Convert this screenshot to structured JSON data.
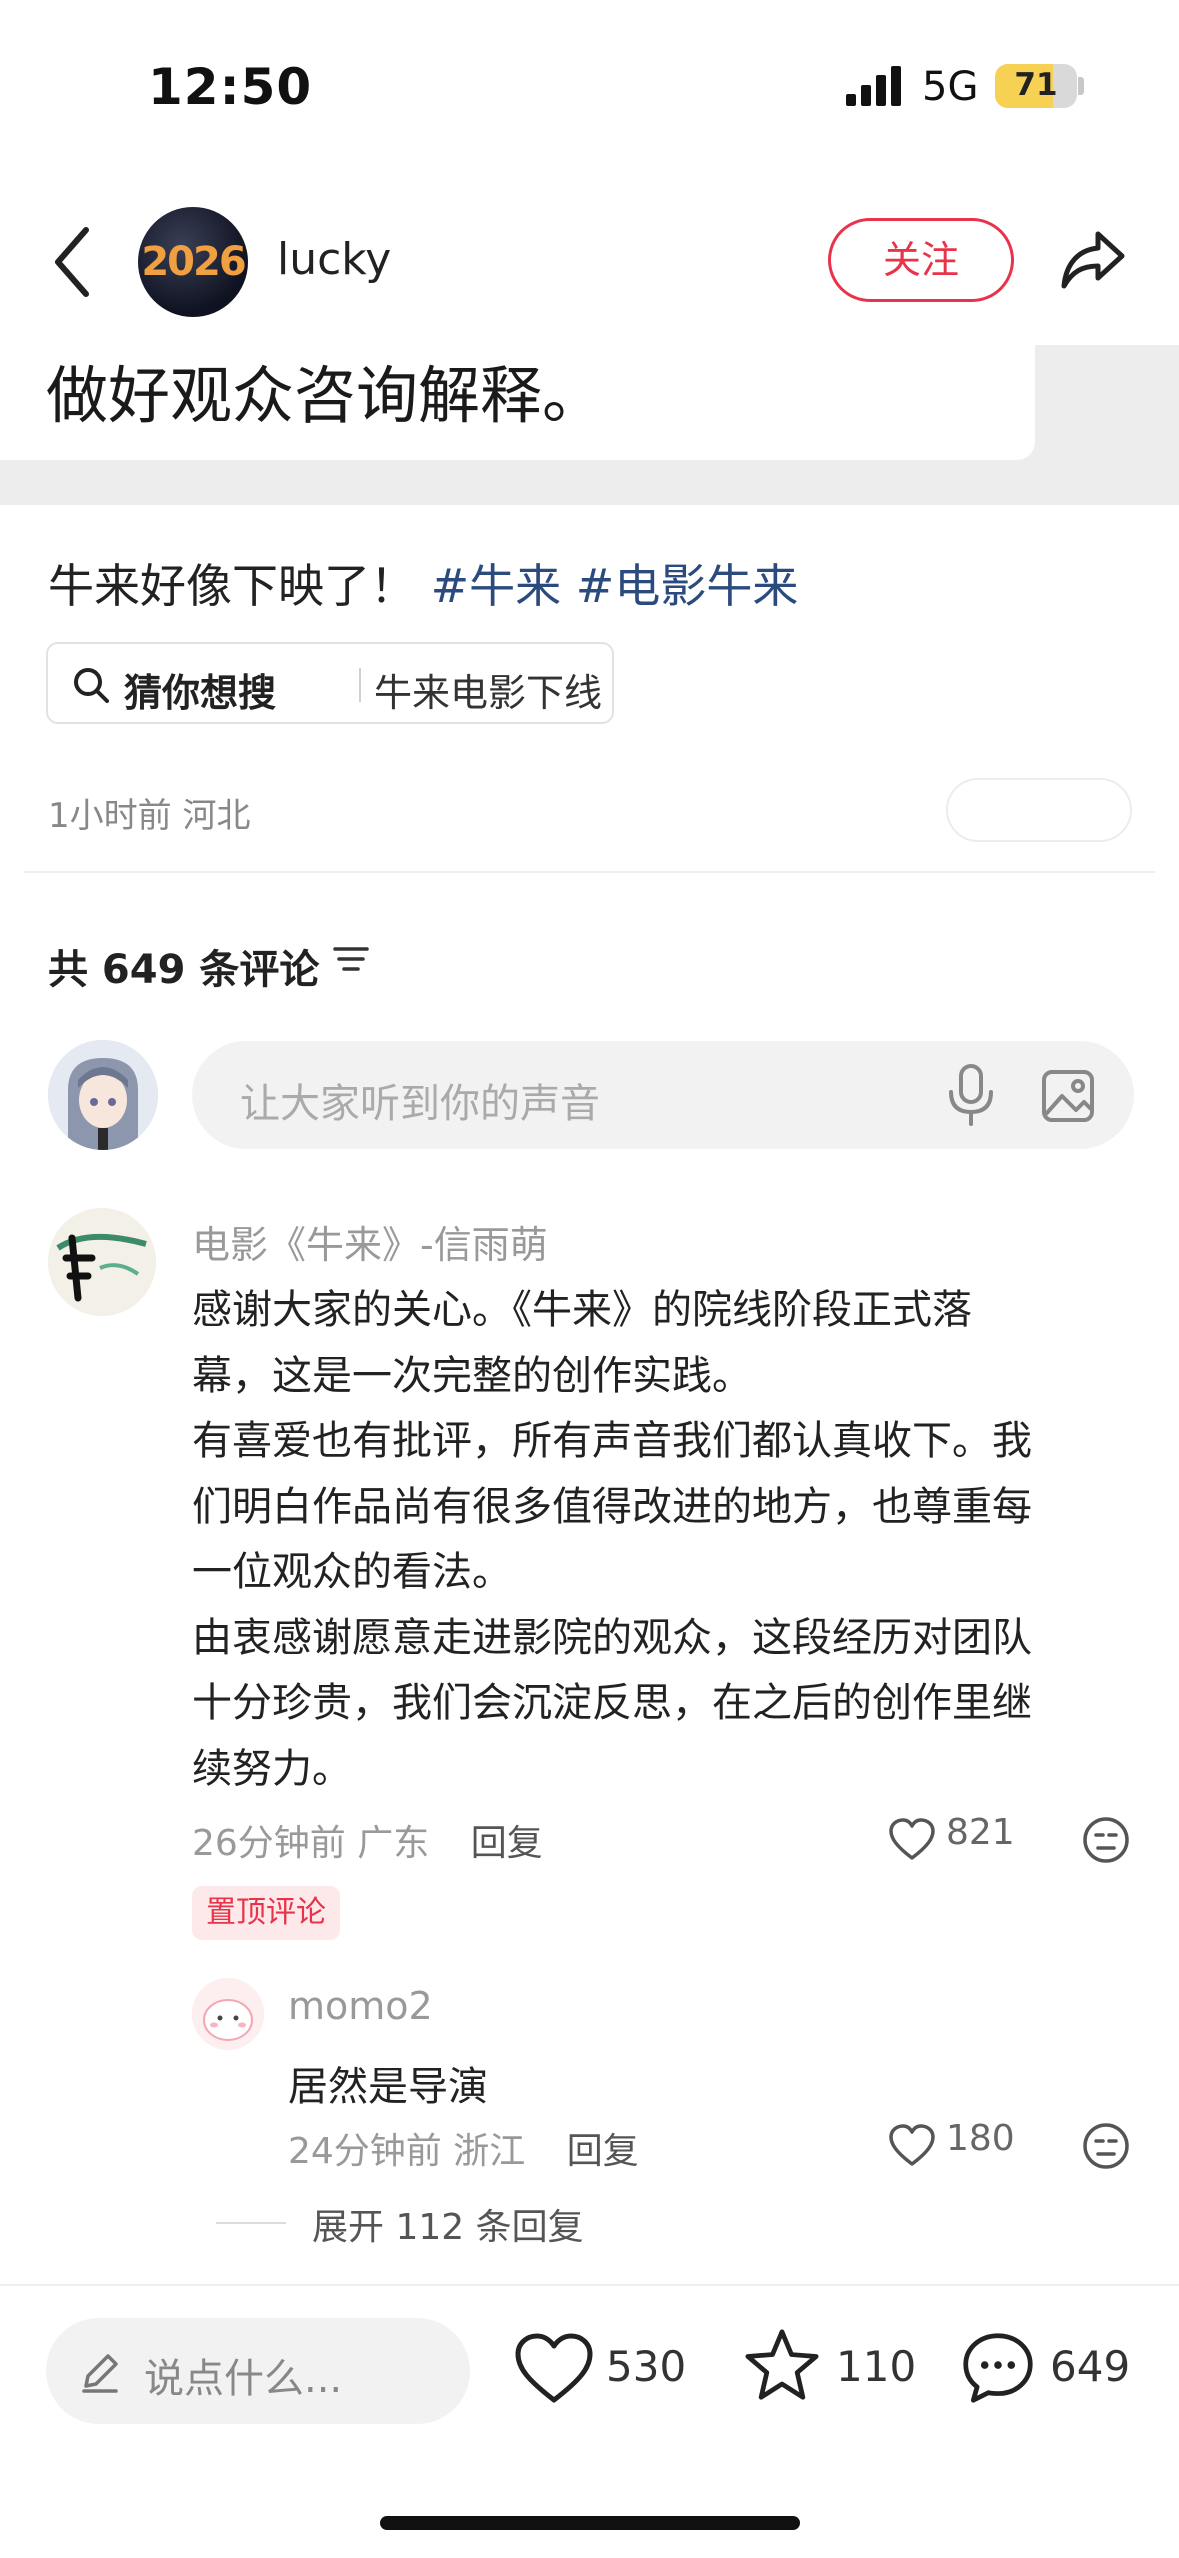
{
  "status_bar": {
    "time": "12:50",
    "network": "5G",
    "battery": "71",
    "battery_level": 0.71
  },
  "header": {
    "username": "lucky",
    "avatar_text": "2026",
    "follow_label": "关注"
  },
  "embedded_card": {
    "text": "做好观众咨询解释。"
  },
  "post": {
    "text": "牛来好像下映了！",
    "hashtags": [
      "#牛来",
      "#电影牛来"
    ],
    "suggest_lead": "猜你想搜",
    "suggest_term": "牛来电影下线",
    "time_location": "1小时前 河北"
  },
  "comments_header": {
    "label": "共 649 条评论"
  },
  "comment_input": {
    "placeholder": "让大家听到你的声音"
  },
  "comments": [
    {
      "author": "电影《牛来》-信雨萌",
      "body": "感谢大家的关心。《牛来》的院线阶段正式落\n幕，这是一次完整的创作实践。\n有喜爱也有批评，所有声音我们都认真收下。我\n们明白作品尚有很多值得改进的地方，也尊重每\n一位观众的看法。\n由衷感谢愿意走进影院的观众，这段经历对团队\n十分珍贵，我们会沉淀反思，在之后的创作里继\n续努力。",
      "meta": "26分钟前 广东",
      "reply_label": "回复",
      "likes": "821",
      "badge": "置顶评论",
      "reply": {
        "author": "momo2",
        "body": "居然是导演",
        "meta": "24分钟前 浙江",
        "reply_label": "回复",
        "likes": "180"
      },
      "expand_label": "展开 112 条回复"
    }
  ],
  "bottom_bar": {
    "say_placeholder": "说点什么...",
    "likes": "530",
    "favorites": "110",
    "comments": "649"
  },
  "colors": {
    "accent": "#e8334a",
    "hashtag": "#2b4a7d",
    "battery": "#f7d154"
  }
}
